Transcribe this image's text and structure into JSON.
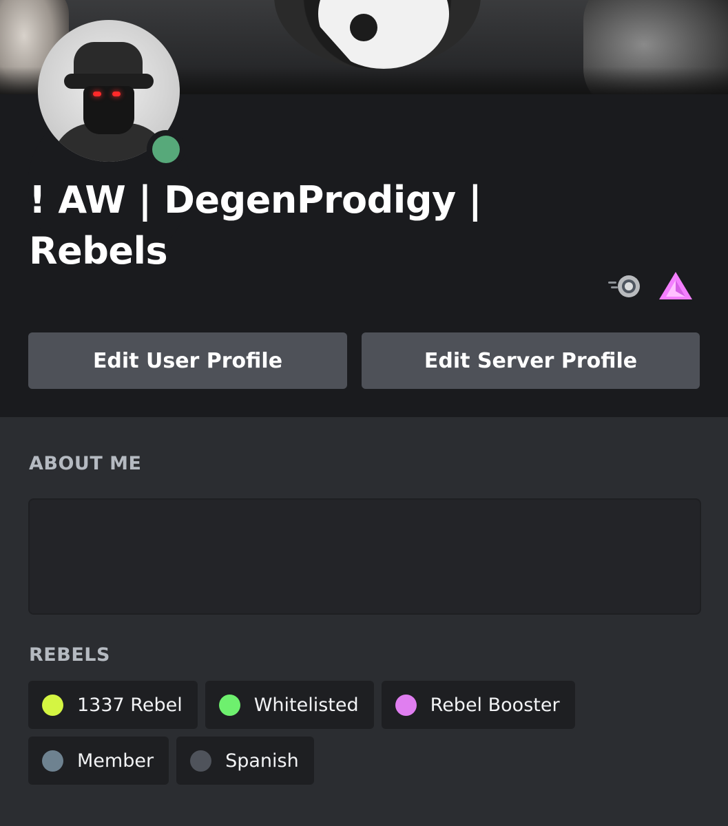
{
  "profile": {
    "display_name": "! AW | DegenProdigy | Rebels",
    "status": "online",
    "status_color": "#57a97a",
    "badges": [
      {
        "icon": "nitro-badge-icon",
        "color": "#b9bbbe"
      },
      {
        "icon": "server-boost-badge-icon",
        "color": "#f47fff"
      }
    ]
  },
  "actions": {
    "edit_user_profile": "Edit User Profile",
    "edit_server_profile": "Edit Server Profile"
  },
  "about_me": {
    "title": "ABOUT ME",
    "text": ""
  },
  "roles": {
    "title": "REBELS",
    "items": [
      {
        "label": "1337 Rebel",
        "color": "#d4f542"
      },
      {
        "label": "Whitelisted",
        "color": "#6ef06e"
      },
      {
        "label": "Rebel Booster",
        "color": "#e07ef0"
      },
      {
        "label": "Member",
        "color": "#6e8290"
      },
      {
        "label": "Spanish",
        "color": "#4f535b"
      }
    ]
  }
}
